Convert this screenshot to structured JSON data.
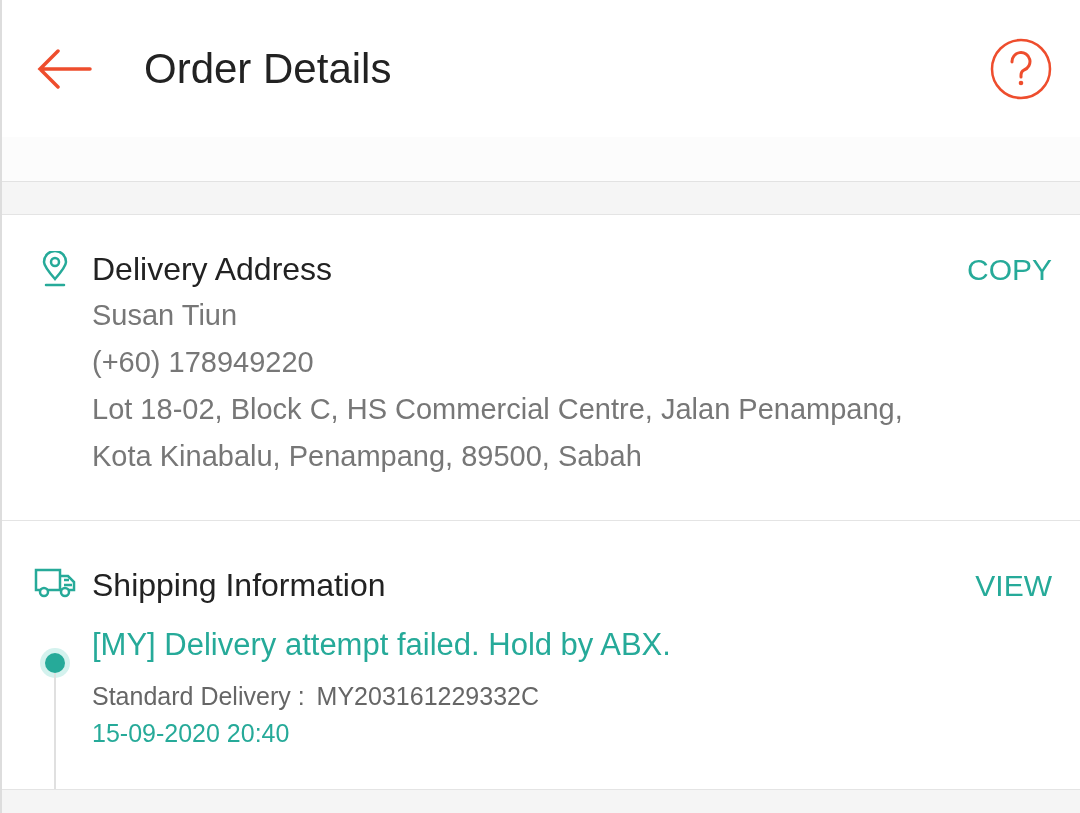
{
  "header": {
    "title": "Order Details"
  },
  "delivery_address": {
    "title": "Delivery Address",
    "action": "COPY",
    "lines": [
      "Susan Tiun",
      "(+60) 178949220",
      "Lot 18-02, Block C, HS Commercial Centre, Jalan Penampang,",
      "Kota Kinabalu, Penampang, 89500, Sabah"
    ]
  },
  "shipping_information": {
    "title": "Shipping Information",
    "action": "VIEW",
    "status": "[MY] Delivery attempt failed. Hold by ABX.",
    "service": "Standard Delivery :",
    "tracking_number": "MY203161229332C",
    "time": "15-09-2020 20:40"
  }
}
